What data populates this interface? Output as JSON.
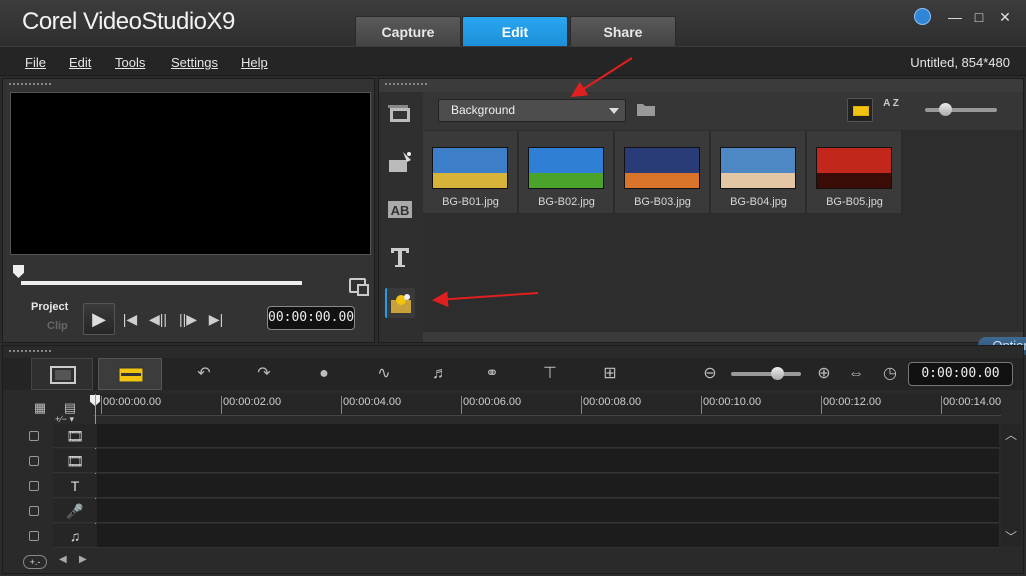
{
  "app": {
    "title_main": "Corel VideoStudio",
    "title_ver": "X9",
    "tabs": [
      "Capture",
      "Edit",
      "Share"
    ],
    "active_tab": "Edit",
    "window_controls": {
      "minimize": "—",
      "maximize": "□",
      "close": "✕"
    }
  },
  "menu": {
    "items": [
      "File",
      "Edit",
      "Tools",
      "Settings",
      "Help"
    ],
    "project_info": "Untitled, 854*480"
  },
  "preview": {
    "mode_project": "Project",
    "mode_clip": "Clip",
    "play": "▶",
    "transport": [
      "|◀",
      "◀||",
      "||▶",
      "▶|"
    ],
    "timecode": "00:00:00.00",
    "playback_position": 0
  },
  "library": {
    "dropdown_value": "Background",
    "sort_label": "A Z",
    "thumb_size_fraction": 0.25,
    "thumbnails": [
      {
        "name": "BG-B01.jpg",
        "sky": "#3d7ec8",
        "ground": "#d7b33a"
      },
      {
        "name": "BG-B02.jpg",
        "sky": "#2f7fd6",
        "ground": "#4aa42b"
      },
      {
        "name": "BG-B03.jpg",
        "sky": "#2a3c78",
        "ground": "#d9742a"
      },
      {
        "name": "BG-B04.jpg",
        "sky": "#4e88c4",
        "ground": "#e3c7a4"
      },
      {
        "name": "BG-B05.jpg",
        "sky": "#c2271b",
        "ground": "#3b0b06"
      }
    ],
    "options_label": "Options ⌃",
    "side_icons": [
      "media-icon",
      "fx-icon",
      "transition-icon",
      "title-icon",
      "graphics-icon"
    ]
  },
  "timeline": {
    "timecode": "0:00:00.00",
    "ruler_ticks": [
      "00:00:00.00",
      "00:00:02.00",
      "00:00:04.00",
      "00:00:06.00",
      "00:00:08.00",
      "00:00:10.00",
      "00:00:12.00",
      "00:00:14.00"
    ],
    "add_remove": "+∕− ▾",
    "zoom_fraction": 0.6,
    "track_icons": [
      "🎞",
      "🎞",
      "T",
      "🎤",
      "♫"
    ]
  },
  "colors": {
    "accent": "#1c8fd8",
    "annotation": "#e02020"
  }
}
